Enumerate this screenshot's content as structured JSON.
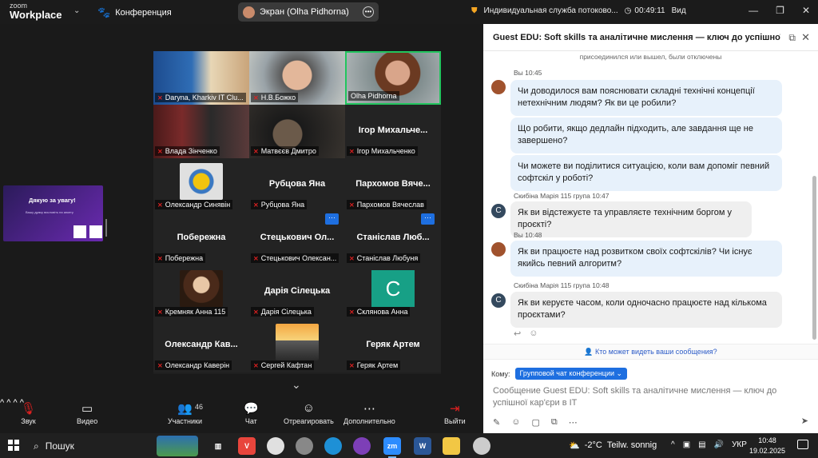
{
  "titlebar": {
    "brand_top": "zoom",
    "brand_bottom": "Workplace",
    "meeting_label": "Конференция",
    "share_label": "Экран (Olha Pidhorna)",
    "service_label": "Индивидуальная служба потоково...",
    "timer": "00:49:11",
    "view_label": "Вид"
  },
  "mini_share": {
    "title": "Дякую за увагу!",
    "subtitle": "Вашу думку висловіть на анкету"
  },
  "gallery": {
    "tiles": [
      {
        "name": "Daryna, Kharkiv IT Clu...",
        "big": ""
      },
      {
        "name": "Н.В.Божко",
        "big": ""
      },
      {
        "name": "Olha Pidhorna",
        "big": ""
      },
      {
        "name": "Влада Зінченко",
        "big": ""
      },
      {
        "name": "Матвєєв Дмитро",
        "big": ""
      },
      {
        "name": "Ігор Михальченко",
        "big": "Ігор  Михальче..."
      },
      {
        "name": "Олександр Синявін",
        "big": ""
      },
      {
        "name": "Рубцова Яна",
        "big": "Рубцова Яна"
      },
      {
        "name": "Пархомов Вячеслав",
        "big": "Пархомов  Вяче..."
      },
      {
        "name": "Побережна",
        "big": "Побережна"
      },
      {
        "name": "Стецькович Олексан...",
        "big": "Стецькович  Ол..."
      },
      {
        "name": "Станіслав Любуня",
        "big": "Станіслав  Люб..."
      },
      {
        "name": "Кремняк Анна 115",
        "big": ""
      },
      {
        "name": "Дарія Сілецька",
        "big": "Дарія Сілецька"
      },
      {
        "name": "Склянова Анна",
        "big": "",
        "avatar_letter": "C"
      },
      {
        "name": "Олександр Каверін",
        "big": "Олександр  Кав..."
      },
      {
        "name": "Сергей Кафтан",
        "big": ""
      },
      {
        "name": "Геряк Артем",
        "big": "Геряк Артем"
      }
    ]
  },
  "toolbar": {
    "audio": "Звук",
    "video": "Видео",
    "participants": "Участники",
    "participants_count": "46",
    "chat": "Чат",
    "react": "Отреагировать",
    "more": "Дополнительно",
    "leave": "Выйти"
  },
  "chat": {
    "title": "Guest EDU: Soft skills та аналітичне мислення — ключ до успішної кар'є...",
    "system_note": "присоединился или вышел, были отключены",
    "meta1": "Вы 10:45",
    "m1": "Чи доводилося вам пояснювати складні технічні концепції нетехнічним людям? Як ви це робили?",
    "m2": "Що робити, якщо дедлайн підходить, але завдання ще не завершено?",
    "m3": "Чи можете ви поділитися ситуацією, коли вам допоміг певний софтскіл у роботі?",
    "meta2": "Скибіна Марія 115 група 10:47",
    "m4": "Як ви відстежуєте та управляєте технічним боргом у проєкті?",
    "meta3": "Вы 10:48",
    "m5": "Як ви працюєте над розвитком своїх софтскілів? Чи існує якийсь певний алгоритм?",
    "meta4": "Скибіна Марія 115 група 10:48",
    "m6": "Як ви керуєте часом, коли одночасно працюєте над кількома проєктами?",
    "avatar_letter": "С",
    "who_sees": "Кто может видеть ваши сообщения?",
    "to_label": "Кому:",
    "to_value": "Групповой чат конференции",
    "input_placeholder": "Сообщение Guest EDU: Soft skills та аналітичне мислення — ключ до успішної кар'єри в IT"
  },
  "taskbar": {
    "search": "Пошук",
    "temp": "-2°C",
    "weather": "Teilw. sonnig",
    "lang": "УКР",
    "time": "10:48",
    "date": "19.02.2025",
    "zoom_app": "zm",
    "word_app": "W"
  }
}
